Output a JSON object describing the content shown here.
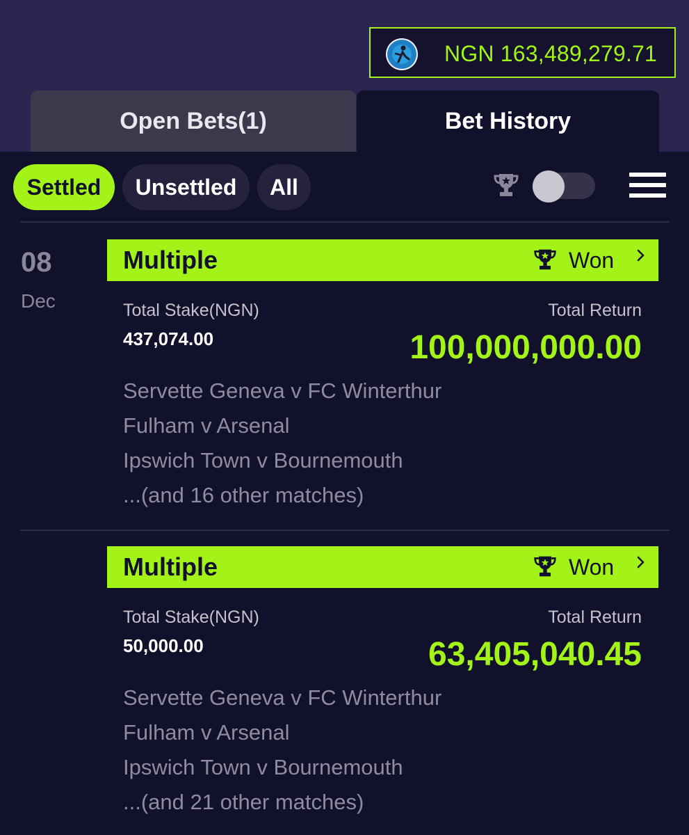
{
  "header": {
    "balance": "NGN 163,489,279.71",
    "avatar_icon": "user-avatar-icon",
    "accent_color": "#a3f318"
  },
  "tabs": [
    {
      "label": "Open Bets(1)",
      "selected": false
    },
    {
      "label": "Bet History",
      "selected": true
    }
  ],
  "filters": {
    "settled": "Settled",
    "unsettled": "Unsettled",
    "all": "All",
    "selected": "Settled",
    "trophy_toggle_on": false
  },
  "date": {
    "day": "08",
    "month": "Dec"
  },
  "bets": [
    {
      "type": "Multiple",
      "status": "Won",
      "stake_label": "Total Stake(NGN)",
      "stake": "437,074.00",
      "return_label": "Total Return",
      "return": "100,000,000.00",
      "matches": [
        "Servette Geneva v FC Winterthur",
        "Fulham v Arsenal",
        "Ipswich Town v Bournemouth",
        "...(and 16 other matches)"
      ]
    },
    {
      "type": "Multiple",
      "status": "Won",
      "stake_label": "Total Stake(NGN)",
      "stake": "50,000.00",
      "return_label": "Total Return",
      "return": "63,405,040.45",
      "matches": [
        "Servette Geneva v FC Winterthur",
        "Fulham v Arsenal",
        "Ipswich Town v Bournemouth",
        "...(and 21 other matches)"
      ]
    }
  ]
}
